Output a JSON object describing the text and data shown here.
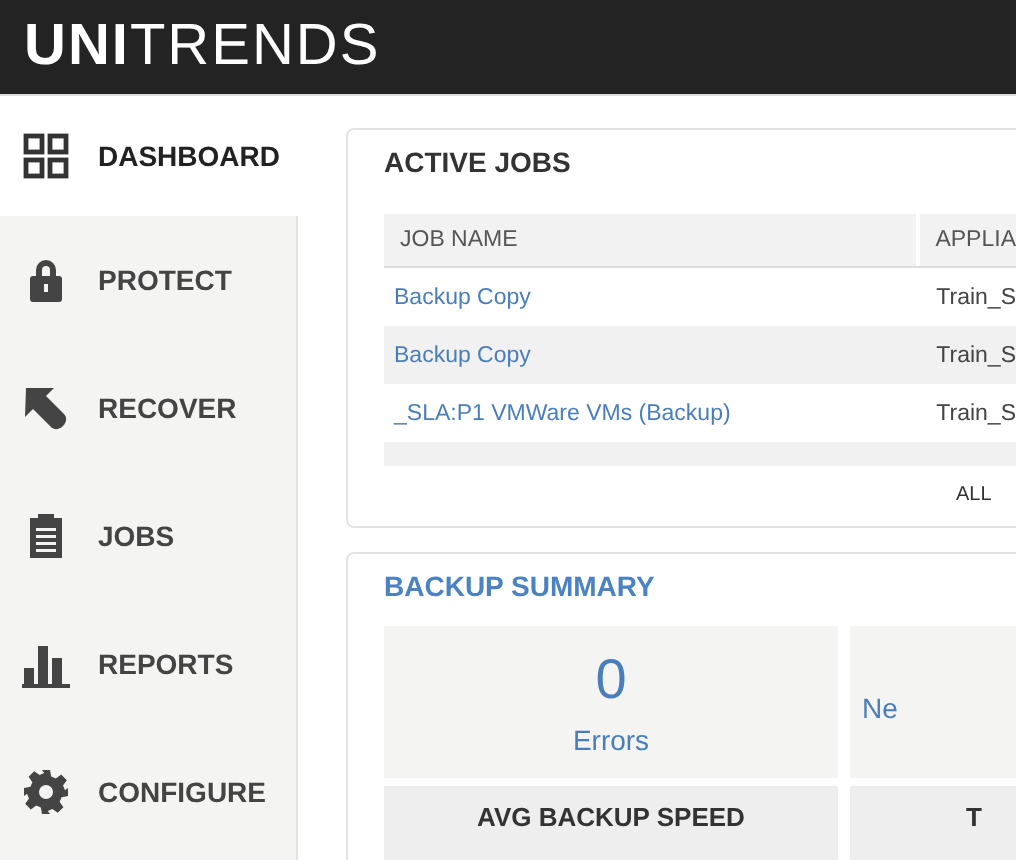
{
  "header": {
    "logo": "**UNI**TRENDS"
  },
  "sidebar": {
    "items": [
      {
        "label": "DASHBOARD",
        "kind": "grid",
        "selected": true
      },
      {
        "label": "PROTECT",
        "kind": "lock",
        "selected": false
      },
      {
        "label": "RECOVER",
        "kind": "arrow",
        "selected": false
      },
      {
        "label": "JOBS",
        "kind": "clipboard",
        "selected": false
      },
      {
        "label": "REPORTS",
        "kind": "bars",
        "selected": false
      },
      {
        "label": "CONFIGURE",
        "kind": "gear",
        "selected": false
      }
    ]
  },
  "active_jobs": {
    "title": "ACTIVE JOBS",
    "columns": [
      "JOB NAME",
      "APPLIA"
    ],
    "rows": [
      {
        "job_name": "Backup Copy",
        "appliance": "Train_S"
      },
      {
        "job_name": "Backup Copy",
        "appliance": "Train_S"
      },
      {
        "job_name": "_SLA:P1 VMWare VMs (Backup)",
        "appliance": "Train_S"
      }
    ],
    "footer_link": "ALL"
  },
  "backup_summary": {
    "title": "BACKUP SUMMARY",
    "stats": [
      {
        "value": "0",
        "label": "Errors"
      },
      {
        "label": "Ne"
      }
    ],
    "tiles": [
      "AVG BACKUP SPEED",
      "T"
    ]
  }
}
